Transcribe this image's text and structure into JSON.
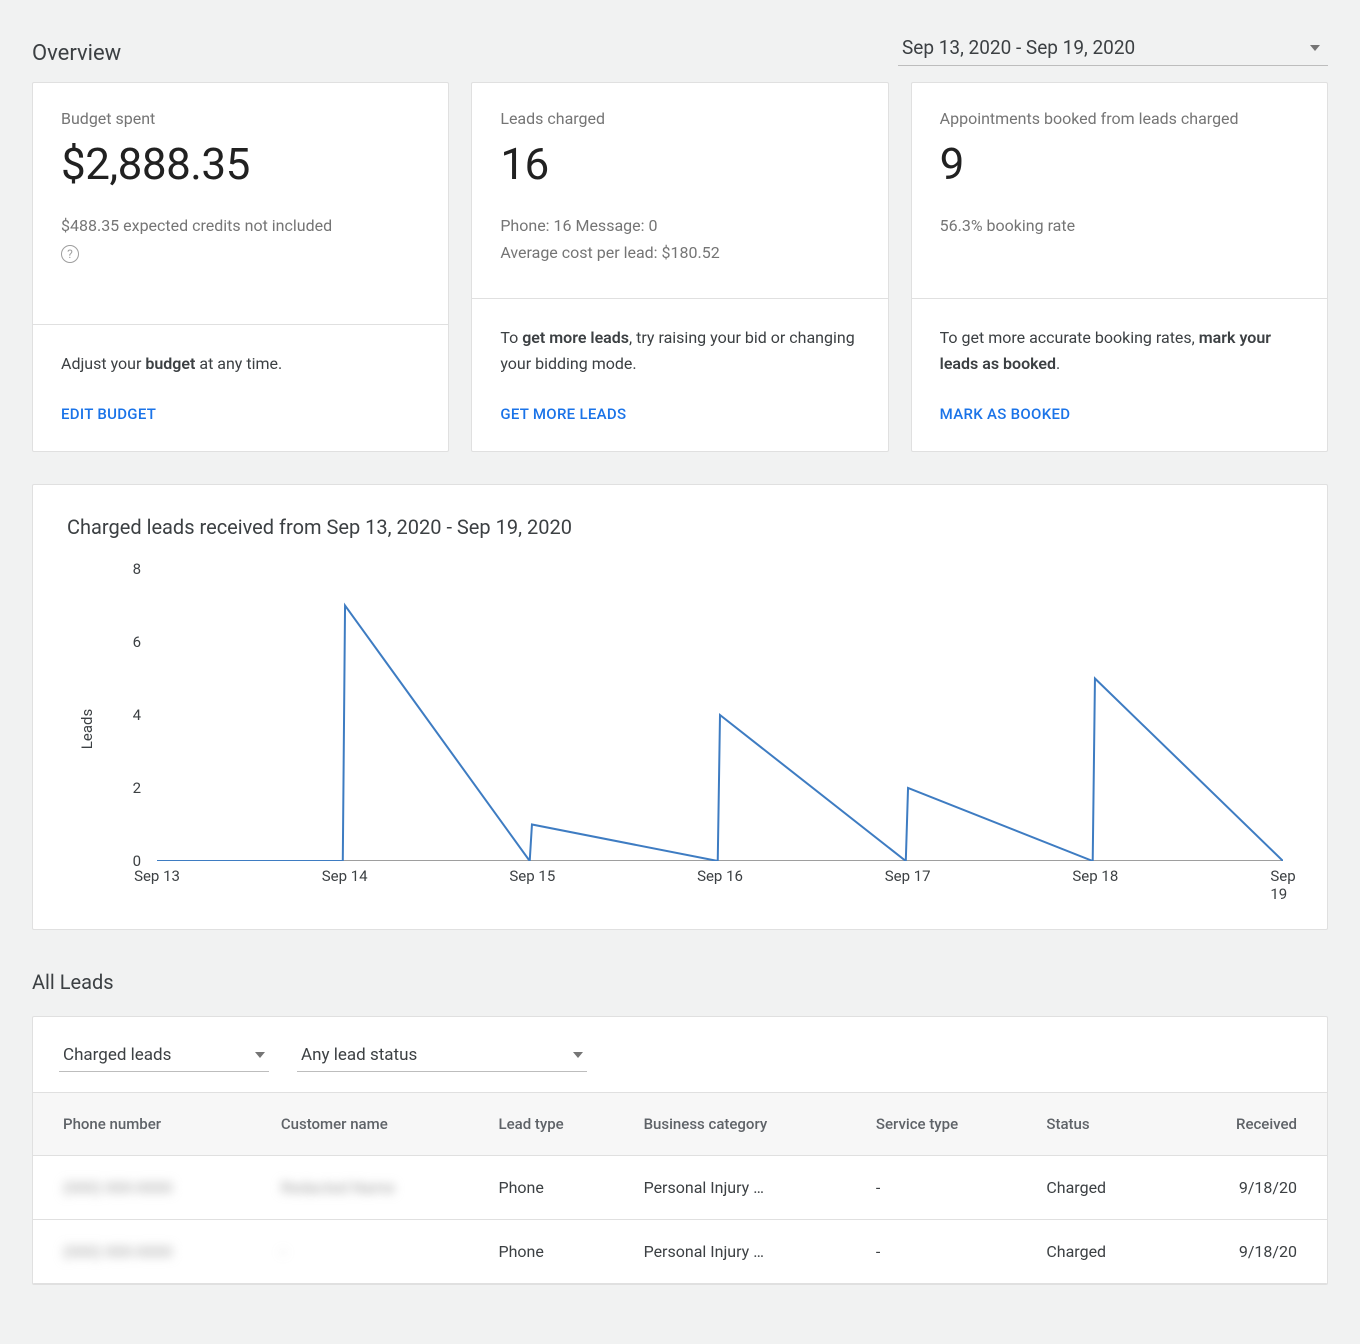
{
  "page_title": "Overview",
  "date_range": "Sep 13, 2020 - Sep 19, 2020",
  "cards": {
    "budget": {
      "label": "Budget spent",
      "value": "$2,888.35",
      "note": "$488.35 expected credits not included",
      "footer_pre": "Adjust your ",
      "footer_bold": "budget",
      "footer_post": " at any time.",
      "action": "EDIT BUDGET"
    },
    "leads": {
      "label": "Leads charged",
      "value": "16",
      "note1": "Phone: 16 Message: 0",
      "note2": "Average cost per lead: $180.52",
      "footer_pre": "To ",
      "footer_bold": "get more leads",
      "footer_post": ", try raising your bid or changing your bidding mode.",
      "action": "GET MORE LEADS"
    },
    "appts": {
      "label": "Appointments booked from leads charged",
      "value": "9",
      "note": "56.3% booking rate",
      "footer_pre": "To get more accurate booking rates, ",
      "footer_bold": "mark your leads as booked",
      "footer_post": ".",
      "action": "MARK AS BOOKED"
    }
  },
  "chart_data": {
    "type": "line",
    "title": "Charged leads received from Sep 13, 2020 - Sep 19, 2020",
    "ylabel": "Leads",
    "xlabel": "",
    "ylim": [
      0,
      8
    ],
    "yticks": [
      0,
      2,
      4,
      6,
      8
    ],
    "categories": [
      "Sep 13",
      "Sep 14",
      "Sep 15",
      "Sep 16",
      "Sep 17",
      "Sep 18",
      "Sep 19"
    ],
    "series": [
      {
        "name": "Charged leads",
        "points": [
          {
            "x": 0.0,
            "y": 0
          },
          {
            "x": 0.165,
            "y": 0
          },
          {
            "x": 0.167,
            "y": 7
          },
          {
            "x": 0.331,
            "y": 0
          },
          {
            "x": 0.333,
            "y": 1
          },
          {
            "x": 0.498,
            "y": 0
          },
          {
            "x": 0.5,
            "y": 4
          },
          {
            "x": 0.665,
            "y": 0
          },
          {
            "x": 0.667,
            "y": 2
          },
          {
            "x": 0.831,
            "y": 0
          },
          {
            "x": 0.833,
            "y": 5
          },
          {
            "x": 1.0,
            "y": 0
          }
        ]
      }
    ]
  },
  "all_leads_title": "All Leads",
  "filters": {
    "type": "Charged leads",
    "status": "Any lead status"
  },
  "table": {
    "headers": [
      "Phone number",
      "Customer name",
      "Lead type",
      "Business category",
      "Service type",
      "Status",
      "Received"
    ],
    "rows": [
      {
        "phone": "(000) 000-0000",
        "name": "Redacted Name",
        "lead_type": "Phone",
        "category": "Personal Injury …",
        "service": "-",
        "status": "Charged",
        "received": "9/18/20"
      },
      {
        "phone": "(000) 000-0000",
        "name": "-",
        "lead_type": "Phone",
        "category": "Personal Injury …",
        "service": "-",
        "status": "Charged",
        "received": "9/18/20"
      }
    ]
  }
}
